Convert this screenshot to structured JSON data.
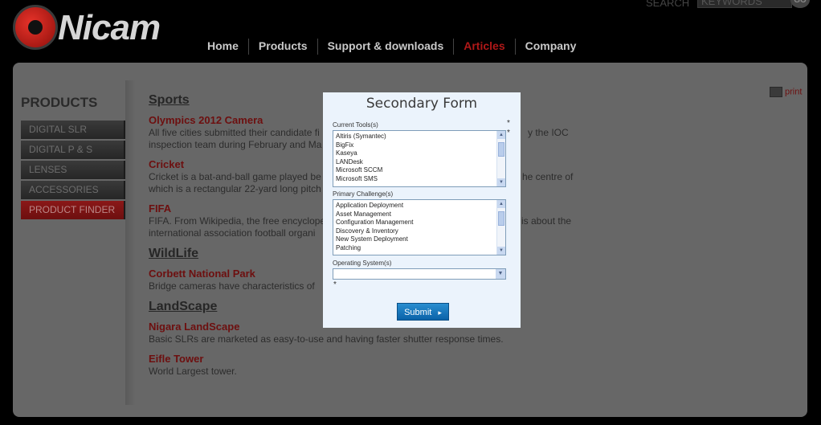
{
  "header": {
    "logo_text": "Nicam",
    "search_label": "SEARCH",
    "search_placeholder": "KEYWORDS",
    "search_go": "GO",
    "nav": [
      {
        "label": "Home"
      },
      {
        "label": "Products"
      },
      {
        "label": "Support & downloads"
      },
      {
        "label": "Articles"
      },
      {
        "label": "Company"
      }
    ]
  },
  "sidebar": {
    "title": "PRODUCTS",
    "items": [
      {
        "label": "DIGITAL SLR"
      },
      {
        "label": "DIGITAL P & S"
      },
      {
        "label": "LENSES"
      },
      {
        "label": "ACCESSORIES"
      },
      {
        "label": "PRODUCT FINDER"
      }
    ]
  },
  "print_label": "print",
  "articles": {
    "sports_title": "Sports",
    "olympics_title": "Olympics 2012 Camera",
    "olympics_text_1": "All five cities submitted their candidate fi",
    "olympics_text_1b": "y the IOC",
    "olympics_text_2": "inspection team during February and Ma",
    "cricket_title": "Cricket",
    "cricket_text_1": "Cricket is a bat-and-ball game played be",
    "cricket_text_1b": "he centre of",
    "cricket_text_2": "which is a rectangular 22-yard long pitch",
    "fifa_title": "FIFA",
    "fifa_text_1": "FIFA. From Wikipedia, the free encyclope",
    "fifa_text_1b": "is about the",
    "fifa_text_2": "international association football organi",
    "wildlife_title": "WildLife",
    "corbett_title": "Corbett National Park",
    "corbett_text": "Bridge cameras have characteristics of",
    "landscape_title": "LandScape",
    "nigara_title": "Nigara LandScape",
    "nigara_text": "Basic SLRs are marketed as easy-to-use and having faster shutter response times.",
    "eifle_title": "Eifle Tower",
    "eifle_text": "World Largest tower."
  },
  "modal": {
    "title": "Secondary Form",
    "current_tools_label": "Current Tools(s)",
    "current_tools": [
      "Altiris (Symantec)",
      "BigFix",
      "Kaseya",
      "LANDesk",
      "Microsoft SCCM",
      "Microsoft SMS"
    ],
    "primary_challenge_label": "Primary Challenge(s)",
    "primary_challenges": [
      "Application Deployment",
      "Asset Management",
      "Configuration Management",
      "Discovery & Inventory",
      "New System Deployment",
      "Patching"
    ],
    "os_label": "Operating System(s)",
    "os_value": "",
    "required_mark": "*",
    "submit_label": "Submit",
    "submit_arrow": "▸"
  }
}
